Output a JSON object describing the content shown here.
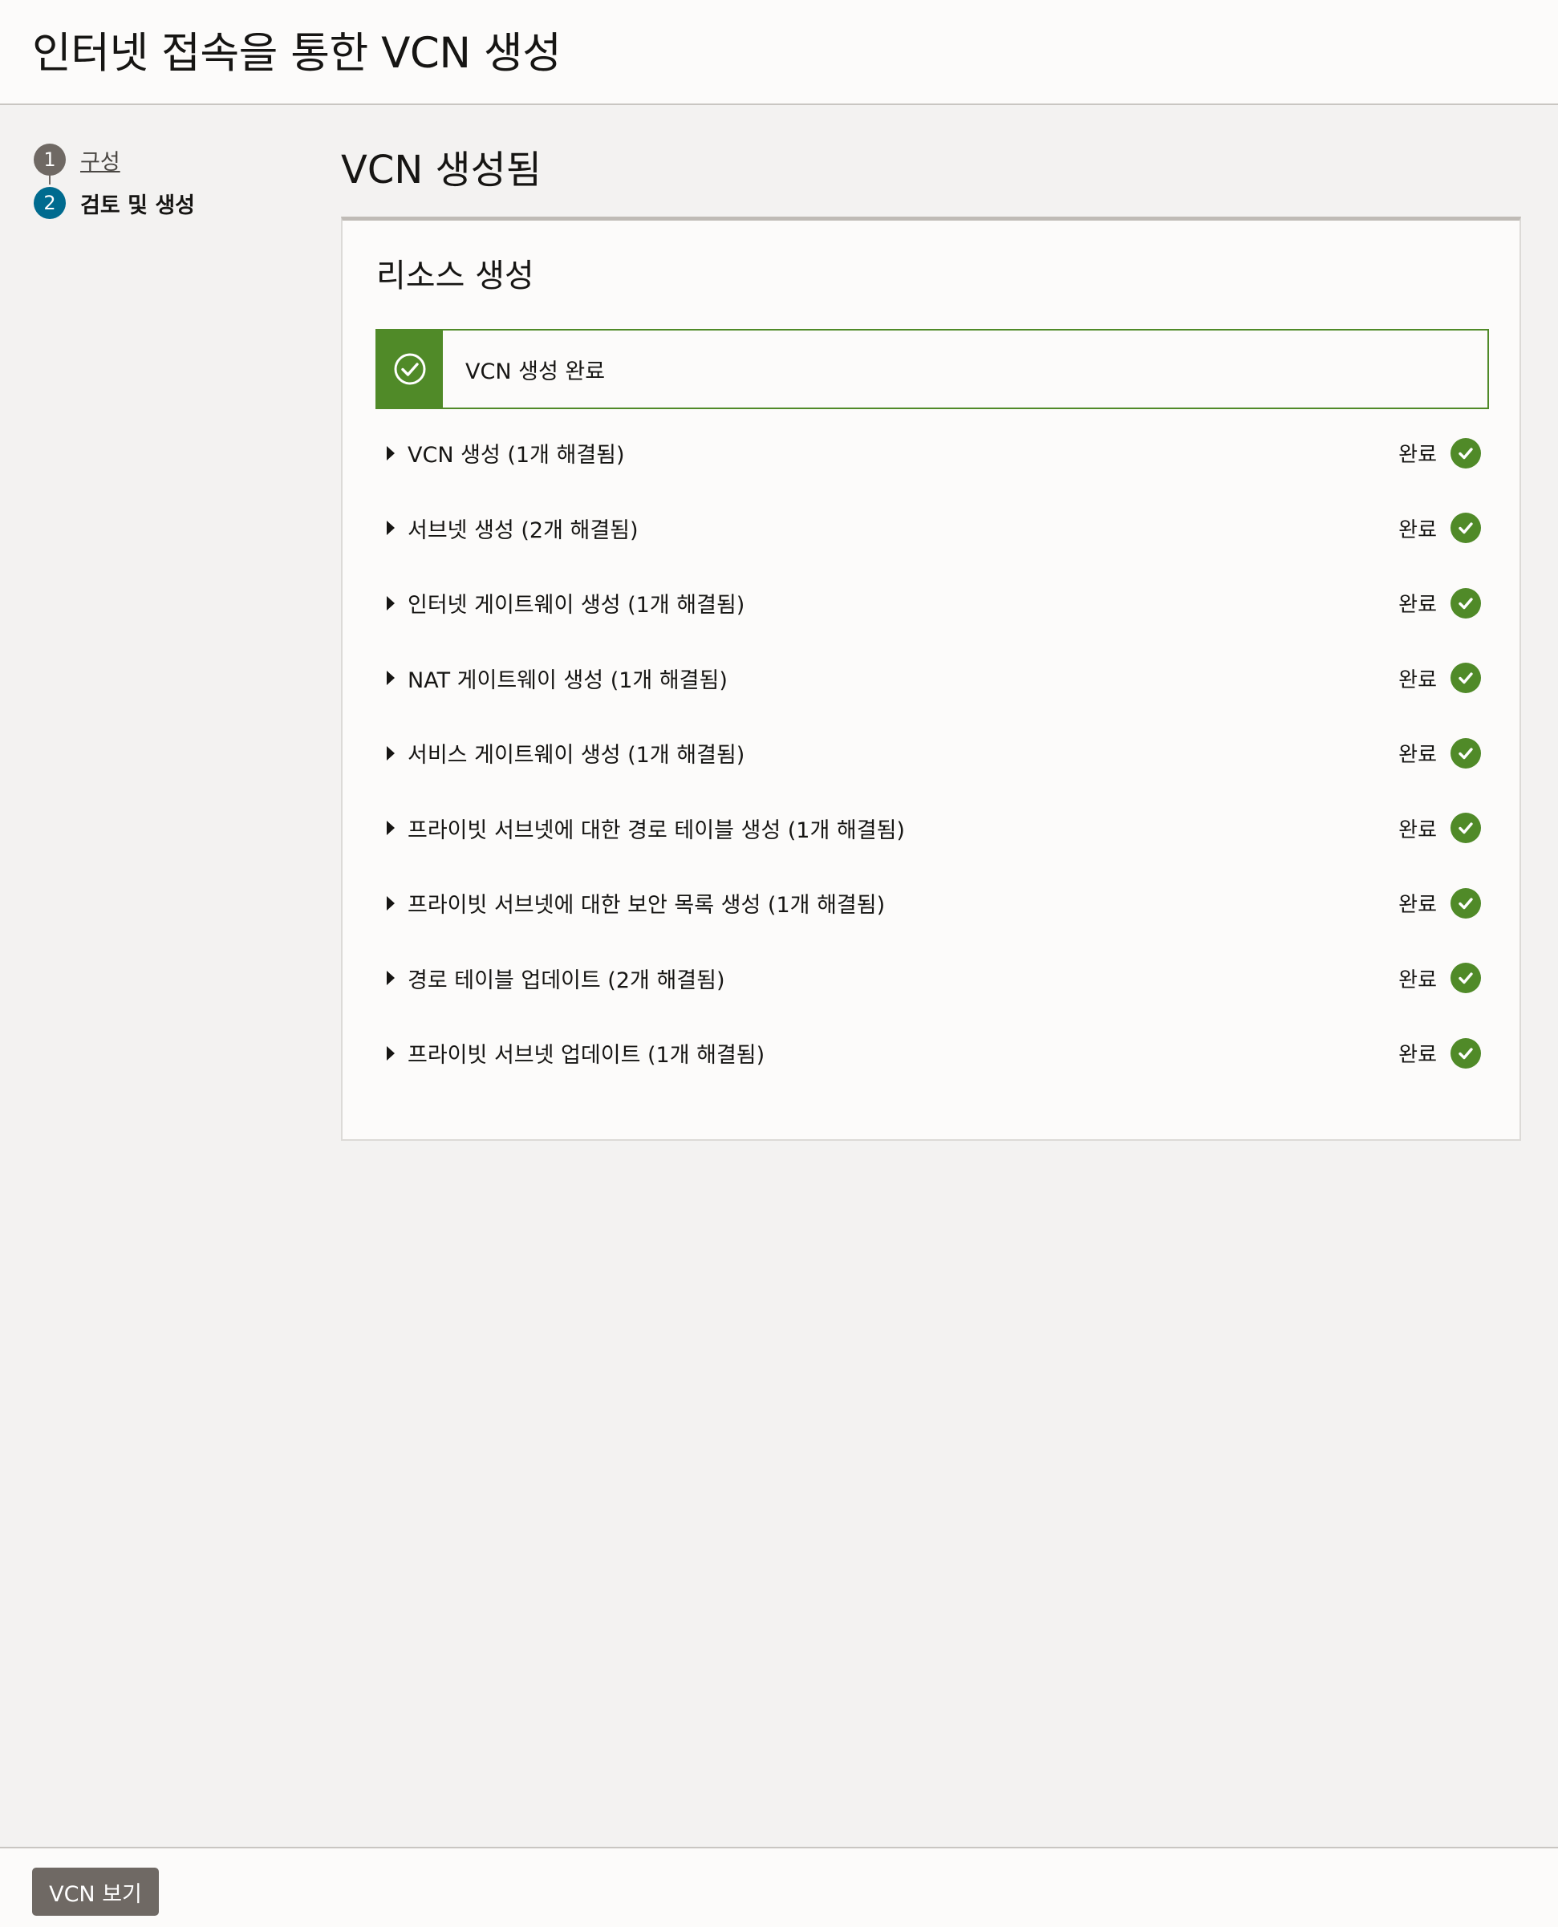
{
  "header": {
    "title": "인터넷 접속을 통한 VCN 생성"
  },
  "steps": [
    {
      "number": "1",
      "label": "구성"
    },
    {
      "number": "2",
      "label": "검토 및 생성"
    }
  ],
  "main": {
    "title": "VCN 생성됨"
  },
  "card": {
    "title": "리소스 생성",
    "banner": {
      "text": "VCN 생성 완료",
      "icon": "check-circle-icon"
    },
    "rows": [
      {
        "label": "VCN 생성 (1개 해결됨)",
        "status": "완료"
      },
      {
        "label": "서브넷 생성 (2개 해결됨)",
        "status": "완료"
      },
      {
        "label": "인터넷 게이트웨이 생성 (1개 해결됨)",
        "status": "완료"
      },
      {
        "label": "NAT 게이트웨이 생성 (1개 해결됨)",
        "status": "완료"
      },
      {
        "label": "서비스 게이트웨이 생성 (1개 해결됨)",
        "status": "완료"
      },
      {
        "label": "프라이빗 서브넷에 대한 경로 테이블 생성 (1개 해결됨)",
        "status": "완료"
      },
      {
        "label": "프라이빗 서브넷에 대한 보안 목록 생성 (1개 해결됨)",
        "status": "완료"
      },
      {
        "label": "경로 테이블 업데이트 (2개 해결됨)",
        "status": "완료"
      },
      {
        "label": "프라이빗 서브넷 업데이트 (1개 해결됨)",
        "status": "완료"
      }
    ]
  },
  "footer": {
    "view_button": "VCN 보기"
  },
  "colors": {
    "success": "#508a28",
    "step_current": "#006b8f",
    "button": "#6f6964"
  }
}
